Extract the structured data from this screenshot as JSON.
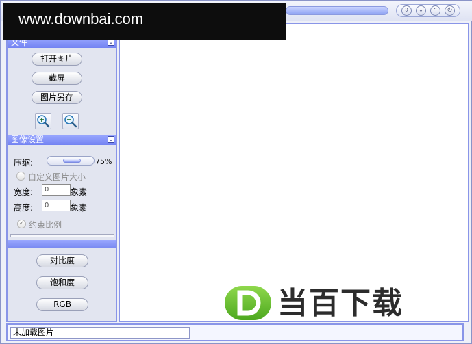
{
  "watermark": {
    "text": "www.downbai.com"
  },
  "window_controls": [
    {
      "name": "restore",
      "glyph": "⇳"
    },
    {
      "name": "minimize",
      "glyph": "⌄"
    },
    {
      "name": "maximize",
      "glyph": "⌃"
    },
    {
      "name": "power",
      "glyph": "⏻"
    }
  ],
  "sidebar": {
    "file_section": {
      "title": "文件",
      "open_label": "打开图片",
      "screenshot_label": "截屏",
      "save_as_label": "图片另存",
      "collapse_glyph": "⌄"
    },
    "image_settings": {
      "title": "图像设置",
      "collapse_glyph": "⌄",
      "compress_label": "压缩:",
      "compress_value": "75%",
      "compress_fraction": 0.75,
      "custom_size_label": "自定义图片大小",
      "width_label": "宽度:",
      "width_value": "0",
      "width_unit": "象素",
      "height_label": "高度:",
      "height_value": "0",
      "height_unit": "象素",
      "keep_ratio_label": "约束比例",
      "keep_ratio_checked": true
    },
    "adjust": {
      "contrast_label": "对比度",
      "saturation_label": "饱和度",
      "rgb_label": "RGB"
    }
  },
  "status": {
    "text": "未加载图片"
  },
  "brand": {
    "text": "当百下载",
    "letter": "D"
  },
  "colors": {
    "accent": "#7f8cf4",
    "border": "#8995e8",
    "brand_green": "#6cc534"
  }
}
